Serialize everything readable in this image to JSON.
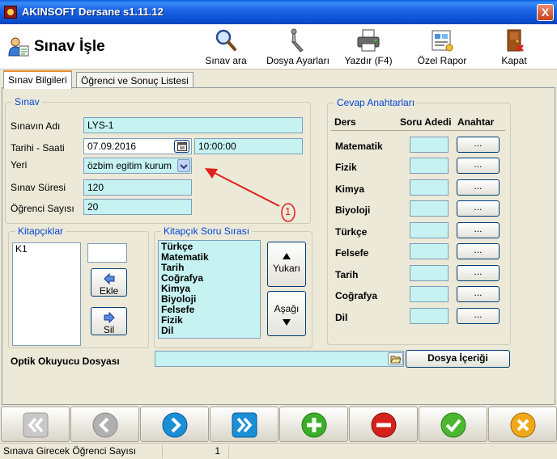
{
  "window": {
    "title": "AKINSOFT Dersane s1.11.12",
    "close": "X"
  },
  "page": {
    "heading": "Sınav İşle"
  },
  "toolbar": {
    "buttons": [
      {
        "label": "Sınav ara",
        "icon": "magnifier-icon"
      },
      {
        "label": "Dosya Ayarları",
        "icon": "wrench-icon"
      },
      {
        "label": "Yazdır (F4)",
        "icon": "printer-icon"
      },
      {
        "label": "Özel Rapor",
        "icon": "report-icon"
      },
      {
        "label": "Kapat",
        "icon": "door-exit-icon"
      }
    ]
  },
  "tabs": [
    {
      "label": "Sınav Bilgileri",
      "active": true
    },
    {
      "label": "Öğrenci ve Sonuç Listesi",
      "active": false
    }
  ],
  "exam": {
    "legend": "Sınav",
    "name_label": "Sınavın Adı",
    "name_value": "LYS-1",
    "date_label": "Tarihi - Saati",
    "date_value": "07.09.2016",
    "time_value": "10:00:00",
    "place_label": "Yeri",
    "place_value": "özbim egitim kurum",
    "duration_label": "Sınav Süresi",
    "duration_value": "120",
    "students_label": "Öğrenci Sayısı",
    "students_value": "20"
  },
  "annotation": {
    "number": "1",
    "color": "#e0201a"
  },
  "booklets": {
    "legend": "Kitapçıklar",
    "items": [
      "K1"
    ],
    "input_value": "",
    "add_label": "Ekle",
    "remove_label": "Sil"
  },
  "question_order": {
    "legend": "Kitapçık Soru Sırası",
    "items": [
      "Türkçe",
      "Matematik",
      "Tarih",
      "Coğrafya",
      "Kimya",
      "Biyoloji",
      "Felsefe",
      "Fizik",
      "Dil"
    ],
    "up_label": "Yukarı",
    "down_label": "Aşağı"
  },
  "answer_keys": {
    "legend": "Cevap Anahtarları",
    "col_subject": "Ders",
    "col_count": "Soru Adedi",
    "col_key": "Anahtar",
    "rows": [
      {
        "subject": "Matematik",
        "count": "",
        "button": "..."
      },
      {
        "subject": "Fizik",
        "count": "",
        "button": "..."
      },
      {
        "subject": "Kimya",
        "count": "",
        "button": "..."
      },
      {
        "subject": "Biyoloji",
        "count": "",
        "button": "..."
      },
      {
        "subject": "Türkçe",
        "count": "",
        "button": "..."
      },
      {
        "subject": "Felsefe",
        "count": "",
        "button": "..."
      },
      {
        "subject": "Tarih",
        "count": "",
        "button": "..."
      },
      {
        "subject": "Coğrafya",
        "count": "",
        "button": "..."
      },
      {
        "subject": "Dil",
        "count": "",
        "button": "..."
      }
    ]
  },
  "optic": {
    "label": "Optik Okuyucu Dosyası",
    "value": "",
    "content_button": "Dosya İçeriği"
  },
  "nav": [
    {
      "name": "first-record",
      "icon": "double-chevron-left-icon",
      "color": "#b8b8b8"
    },
    {
      "name": "prev-record",
      "icon": "chevron-left-icon",
      "color": "#a8a8a8"
    },
    {
      "name": "next-record",
      "icon": "chevron-right-icon",
      "color": "#1a8fd6"
    },
    {
      "name": "last-record",
      "icon": "double-chevron-right-icon",
      "color": "#1a8fd6"
    },
    {
      "name": "add-record",
      "icon": "plus-icon",
      "color": "#3cae2a"
    },
    {
      "name": "delete-record",
      "icon": "minus-icon",
      "color": "#d4211c"
    },
    {
      "name": "save-record",
      "icon": "checkmark-icon",
      "color": "#4cb830"
    },
    {
      "name": "cancel-record",
      "icon": "x-icon",
      "color": "#f0a818"
    }
  ],
  "status": {
    "label": "Sınava Girecek Öğrenci Sayısı",
    "value": "1"
  }
}
